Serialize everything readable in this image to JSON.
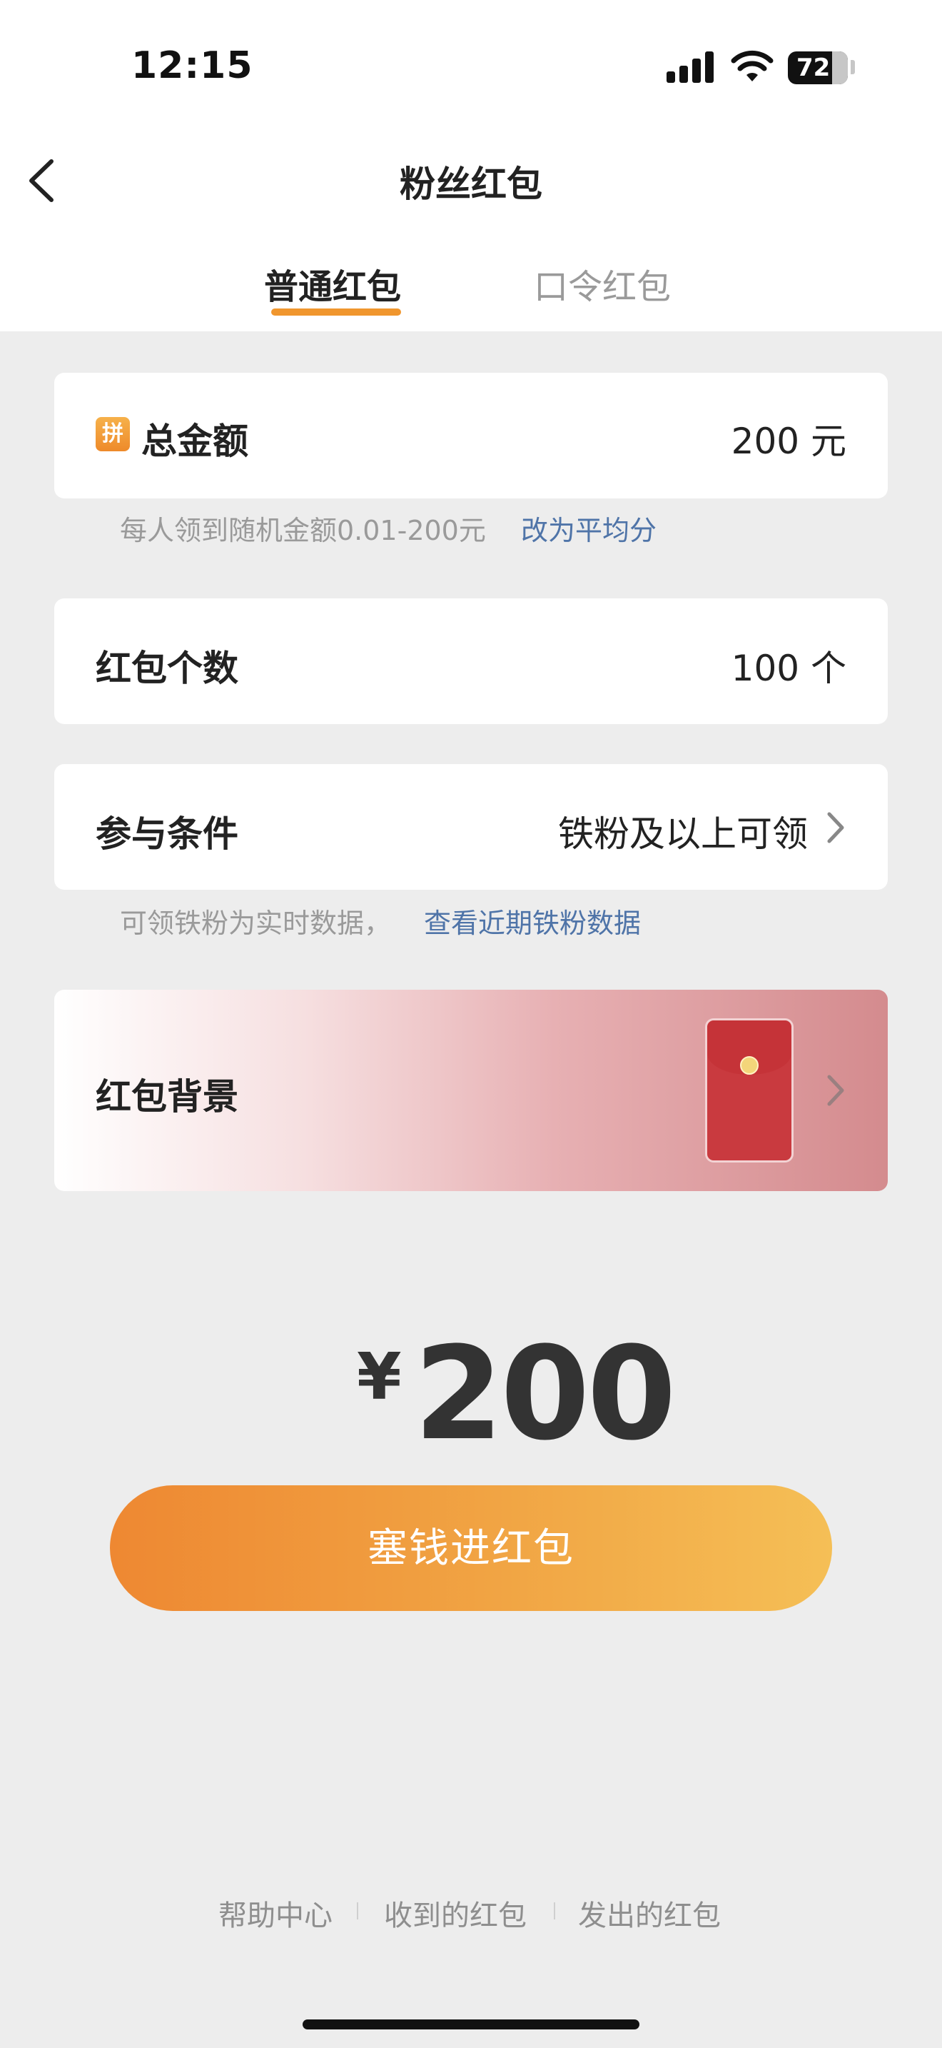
{
  "status_bar": {
    "time": "12:15",
    "battery": "72"
  },
  "nav": {
    "title": "粉丝红包"
  },
  "tabs": [
    {
      "label": "普通红包",
      "active": true
    },
    {
      "label": "口令红包",
      "active": false
    }
  ],
  "amount": {
    "icon_char": "拼",
    "label": "总金额",
    "value": "200 元"
  },
  "amount_hint": {
    "text": "每人领到随机金额0.01-200元",
    "link": "改为平均分"
  },
  "count": {
    "label": "红包个数",
    "value": "100 个"
  },
  "condition": {
    "label": "参与条件",
    "value": "铁粉及以上可领"
  },
  "condition_hint": {
    "text": "可领铁粉为实时数据，",
    "link": "查看近期铁粉数据"
  },
  "background": {
    "label": "红包背景"
  },
  "total": {
    "currency": "¥",
    "amount": "200"
  },
  "action": {
    "label": "塞钱进红包"
  },
  "footer": {
    "links": [
      "帮助中心",
      "收到的红包",
      "发出的红包"
    ]
  },
  "colors": {
    "accent": "#f0962e",
    "link": "#4f74a8",
    "button_start": "#ee8832",
    "button_end": "#f5bf56"
  }
}
